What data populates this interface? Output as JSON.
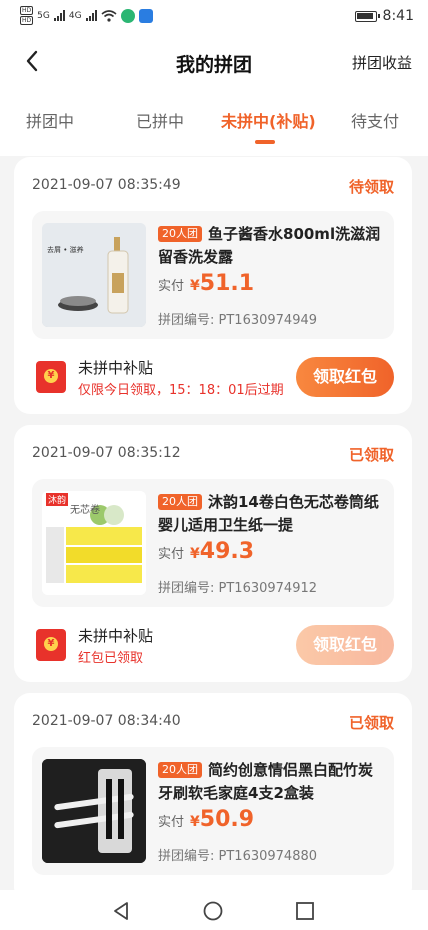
{
  "status_bar": {
    "hd_labels": [
      "HD",
      "HD"
    ],
    "network_1": "5G",
    "network_2": "4G",
    "time": "8:41"
  },
  "header": {
    "title": "我的拼团",
    "earnings_label": "拼团收益"
  },
  "tabs": [
    {
      "label": "拼团中"
    },
    {
      "label": "已拼中"
    },
    {
      "label": "未拼中(补贴)",
      "active": true
    },
    {
      "label": "待支付"
    }
  ],
  "orders": [
    {
      "date": "2021-09-07 08:35:49",
      "status": "待领取",
      "badge": "20人团",
      "title": "鱼子酱香水800ml洗滋润留香洗发露",
      "price_label": "实付",
      "currency": "¥",
      "price": "51.1",
      "code": "拼团编号: PT1630974949",
      "thumb_text": "去屑 • 滋养",
      "subsidy_title": "未拼中补贴",
      "subsidy_note": "仅限今日领取，15：18：01后过期",
      "claim_label": "领取红包",
      "claimed": false
    },
    {
      "date": "2021-09-07 08:35:12",
      "status": "已领取",
      "badge": "20人团",
      "title": "沐韵14卷白色无芯卷筒纸婴儿适用卫生纸一提",
      "price_label": "实付",
      "currency": "¥",
      "price": "49.3",
      "code": "拼团编号: PT1630974912",
      "thumb_text": "沐韵",
      "thumb_text_2": "无芯卷",
      "subsidy_title": "未拼中补贴",
      "subsidy_note": "红包已领取",
      "claim_label": "领取红包",
      "claimed": true
    },
    {
      "date": "2021-09-07 08:34:40",
      "status": "已领取",
      "badge": "20人团",
      "title": "简约创意情侣黑白配竹炭牙刷软毛家庭4支2盒装",
      "price_label": "实付",
      "currency": "¥",
      "price": "50.9",
      "code": "拼团编号: PT1630974880"
    }
  ],
  "colors": {
    "accent": "#f0632a",
    "red": "#e8322b"
  },
  "icons": {
    "back": "chevron-left-icon",
    "red_packet": "red-packet-icon",
    "nav_back": "triangle-back-icon",
    "nav_home": "circle-home-icon",
    "nav_recents": "square-recents-icon"
  }
}
